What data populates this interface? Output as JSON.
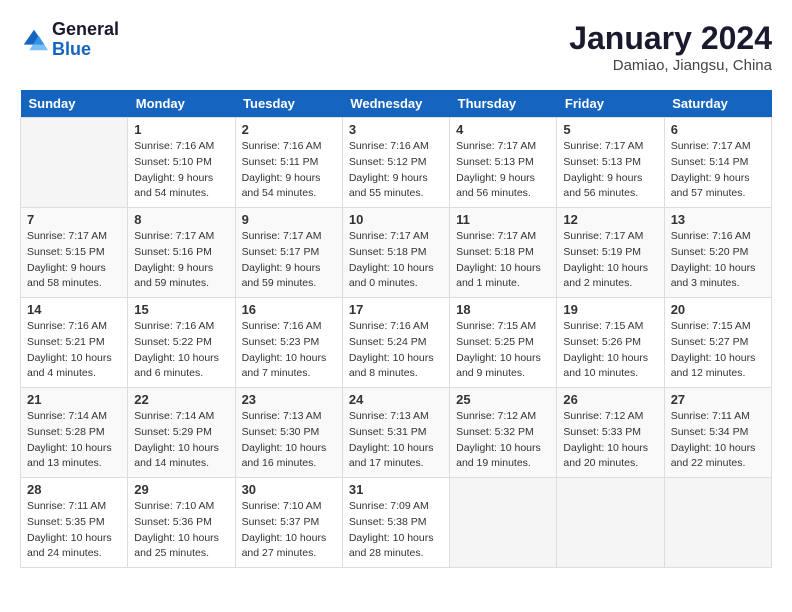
{
  "header": {
    "logo_general": "General",
    "logo_blue": "Blue",
    "month_title": "January 2024",
    "location": "Damiao, Jiangsu, China"
  },
  "weekdays": [
    "Sunday",
    "Monday",
    "Tuesday",
    "Wednesday",
    "Thursday",
    "Friday",
    "Saturday"
  ],
  "weeks": [
    [
      {
        "day": "",
        "info": ""
      },
      {
        "day": "1",
        "info": "Sunrise: 7:16 AM\nSunset: 5:10 PM\nDaylight: 9 hours\nand 54 minutes."
      },
      {
        "day": "2",
        "info": "Sunrise: 7:16 AM\nSunset: 5:11 PM\nDaylight: 9 hours\nand 54 minutes."
      },
      {
        "day": "3",
        "info": "Sunrise: 7:16 AM\nSunset: 5:12 PM\nDaylight: 9 hours\nand 55 minutes."
      },
      {
        "day": "4",
        "info": "Sunrise: 7:17 AM\nSunset: 5:13 PM\nDaylight: 9 hours\nand 56 minutes."
      },
      {
        "day": "5",
        "info": "Sunrise: 7:17 AM\nSunset: 5:13 PM\nDaylight: 9 hours\nand 56 minutes."
      },
      {
        "day": "6",
        "info": "Sunrise: 7:17 AM\nSunset: 5:14 PM\nDaylight: 9 hours\nand 57 minutes."
      }
    ],
    [
      {
        "day": "7",
        "info": "Sunrise: 7:17 AM\nSunset: 5:15 PM\nDaylight: 9 hours\nand 58 minutes."
      },
      {
        "day": "8",
        "info": "Sunrise: 7:17 AM\nSunset: 5:16 PM\nDaylight: 9 hours\nand 59 minutes."
      },
      {
        "day": "9",
        "info": "Sunrise: 7:17 AM\nSunset: 5:17 PM\nDaylight: 9 hours\nand 59 minutes."
      },
      {
        "day": "10",
        "info": "Sunrise: 7:17 AM\nSunset: 5:18 PM\nDaylight: 10 hours\nand 0 minutes."
      },
      {
        "day": "11",
        "info": "Sunrise: 7:17 AM\nSunset: 5:18 PM\nDaylight: 10 hours\nand 1 minute."
      },
      {
        "day": "12",
        "info": "Sunrise: 7:17 AM\nSunset: 5:19 PM\nDaylight: 10 hours\nand 2 minutes."
      },
      {
        "day": "13",
        "info": "Sunrise: 7:16 AM\nSunset: 5:20 PM\nDaylight: 10 hours\nand 3 minutes."
      }
    ],
    [
      {
        "day": "14",
        "info": "Sunrise: 7:16 AM\nSunset: 5:21 PM\nDaylight: 10 hours\nand 4 minutes."
      },
      {
        "day": "15",
        "info": "Sunrise: 7:16 AM\nSunset: 5:22 PM\nDaylight: 10 hours\nand 6 minutes."
      },
      {
        "day": "16",
        "info": "Sunrise: 7:16 AM\nSunset: 5:23 PM\nDaylight: 10 hours\nand 7 minutes."
      },
      {
        "day": "17",
        "info": "Sunrise: 7:16 AM\nSunset: 5:24 PM\nDaylight: 10 hours\nand 8 minutes."
      },
      {
        "day": "18",
        "info": "Sunrise: 7:15 AM\nSunset: 5:25 PM\nDaylight: 10 hours\nand 9 minutes."
      },
      {
        "day": "19",
        "info": "Sunrise: 7:15 AM\nSunset: 5:26 PM\nDaylight: 10 hours\nand 10 minutes."
      },
      {
        "day": "20",
        "info": "Sunrise: 7:15 AM\nSunset: 5:27 PM\nDaylight: 10 hours\nand 12 minutes."
      }
    ],
    [
      {
        "day": "21",
        "info": "Sunrise: 7:14 AM\nSunset: 5:28 PM\nDaylight: 10 hours\nand 13 minutes."
      },
      {
        "day": "22",
        "info": "Sunrise: 7:14 AM\nSunset: 5:29 PM\nDaylight: 10 hours\nand 14 minutes."
      },
      {
        "day": "23",
        "info": "Sunrise: 7:13 AM\nSunset: 5:30 PM\nDaylight: 10 hours\nand 16 minutes."
      },
      {
        "day": "24",
        "info": "Sunrise: 7:13 AM\nSunset: 5:31 PM\nDaylight: 10 hours\nand 17 minutes."
      },
      {
        "day": "25",
        "info": "Sunrise: 7:12 AM\nSunset: 5:32 PM\nDaylight: 10 hours\nand 19 minutes."
      },
      {
        "day": "26",
        "info": "Sunrise: 7:12 AM\nSunset: 5:33 PM\nDaylight: 10 hours\nand 20 minutes."
      },
      {
        "day": "27",
        "info": "Sunrise: 7:11 AM\nSunset: 5:34 PM\nDaylight: 10 hours\nand 22 minutes."
      }
    ],
    [
      {
        "day": "28",
        "info": "Sunrise: 7:11 AM\nSunset: 5:35 PM\nDaylight: 10 hours\nand 24 minutes."
      },
      {
        "day": "29",
        "info": "Sunrise: 7:10 AM\nSunset: 5:36 PM\nDaylight: 10 hours\nand 25 minutes."
      },
      {
        "day": "30",
        "info": "Sunrise: 7:10 AM\nSunset: 5:37 PM\nDaylight: 10 hours\nand 27 minutes."
      },
      {
        "day": "31",
        "info": "Sunrise: 7:09 AM\nSunset: 5:38 PM\nDaylight: 10 hours\nand 28 minutes."
      },
      {
        "day": "",
        "info": ""
      },
      {
        "day": "",
        "info": ""
      },
      {
        "day": "",
        "info": ""
      }
    ]
  ]
}
